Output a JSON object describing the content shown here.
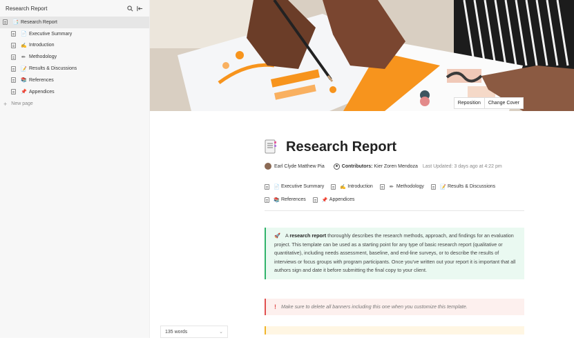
{
  "sidebar": {
    "title": "Research Report",
    "items": [
      {
        "label": "Research Report",
        "emoji": "📑"
      },
      {
        "label": "Executive Summary",
        "emoji": "📄"
      },
      {
        "label": "Introduction",
        "emoji": "✍"
      },
      {
        "label": "Methodology",
        "emoji": "✏"
      },
      {
        "label": "Results & Discussions",
        "emoji": "📝"
      },
      {
        "label": "References",
        "emoji": "📚"
      },
      {
        "label": "Appendices",
        "emoji": "📌"
      }
    ],
    "new_page": "New page"
  },
  "cover": {
    "reposition": "Reposition",
    "change_cover": "Change Cover"
  },
  "doc": {
    "title": "Research Report",
    "author": "Earl Clyde Matthew Pia",
    "contributors_label": "Contributors:",
    "contributors": "Kier Zoren Mendoza",
    "updated": "Last Updated: 3 days ago at 4:22 pm",
    "links": [
      {
        "label": "Executive Summary",
        "emoji": "📄"
      },
      {
        "label": "Introduction",
        "emoji": "✍"
      },
      {
        "label": "Methodology",
        "emoji": "✏"
      },
      {
        "label": "Results & Discussions",
        "emoji": "📝"
      },
      {
        "label": "References",
        "emoji": "📚"
      },
      {
        "label": "Appendices",
        "emoji": "📌"
      }
    ],
    "banner_green": {
      "icon": "🚀",
      "pre": "A ",
      "bold": "research report",
      "post": " thoroughly describes the research methods, approach, and findings for an evaluation project. This template can be used as a starting point for any type of basic research report (qualitative or quantitative), including needs assessment, baseline, and end-line surveys, or to describe the results of interviews or focus groups with program participants. Once you've written out your report it is important that all authors sign and date it before submitting the final copy to your client."
    },
    "banner_red": {
      "icon": "!",
      "text": "Make sure to delete all banners including this one when you customize this template."
    }
  },
  "footer": {
    "word_count": "135 words"
  },
  "colors": {
    "accent_orange": "#f7941d",
    "banner_green": "#2fb36a",
    "banner_red": "#e04f4f",
    "banner_yellow": "#f0b429"
  }
}
